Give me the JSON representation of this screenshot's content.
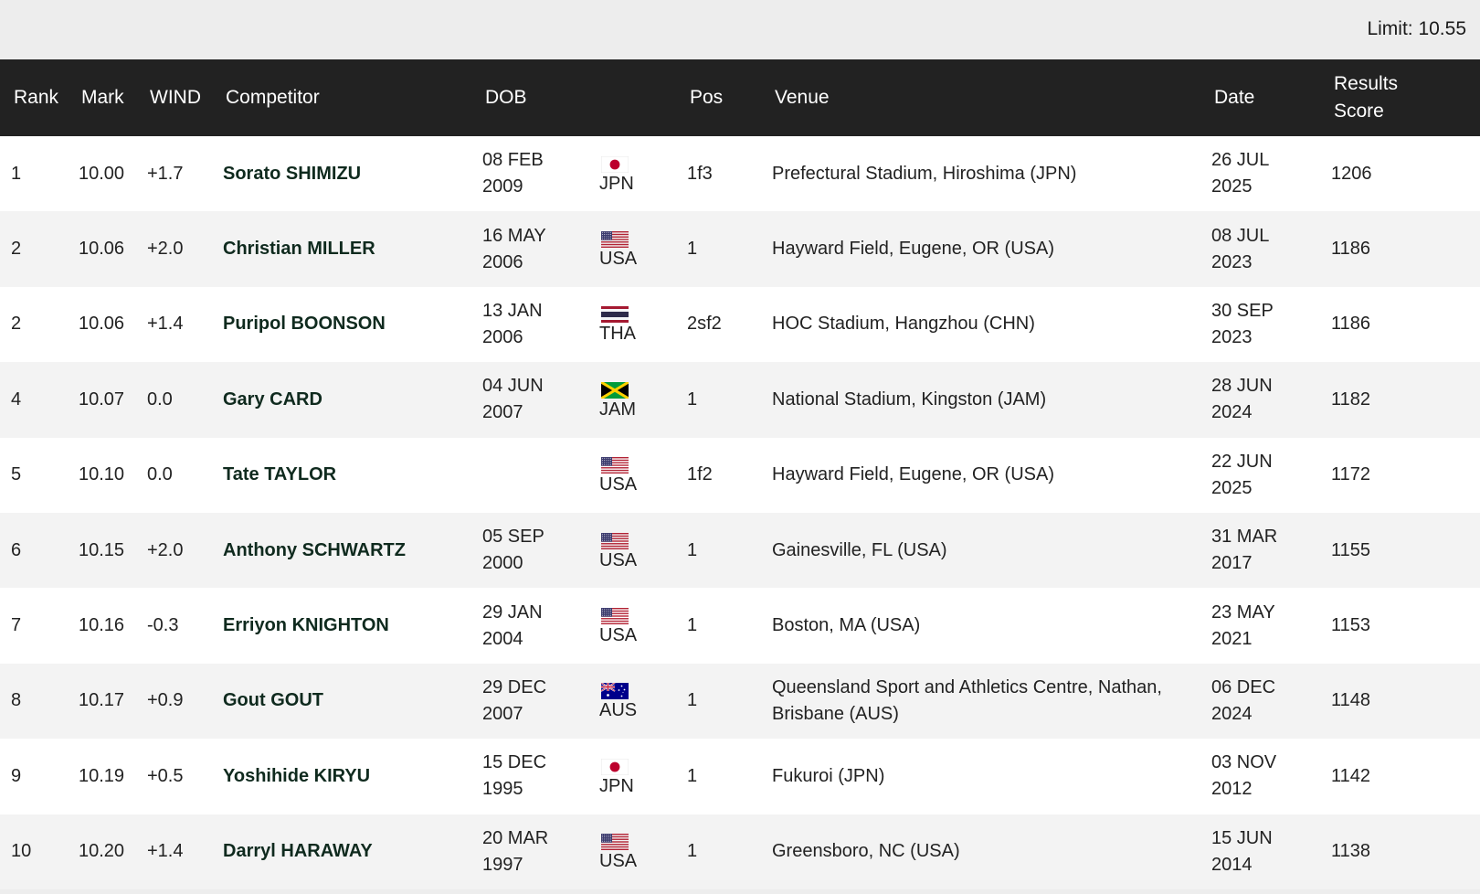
{
  "limit": "Limit: 10.55",
  "headers": {
    "rank": "Rank",
    "mark": "Mark",
    "wind": "WIND",
    "competitor": "Competitor",
    "dob": "DOB",
    "nat": "",
    "pos": "Pos",
    "venue": "Venue",
    "date": "Date",
    "score_line1": "Results",
    "score_line2": "Score"
  },
  "rows": [
    {
      "rank": "1",
      "mark": "10.00",
      "wind": "+1.7",
      "competitor": "Sorato SHIMIZU",
      "dob1": "08 FEB",
      "dob2": "2009",
      "nat": "JPN",
      "flag": "jpn-flag-icon",
      "pos": "1f3",
      "venue": "Prefectural Stadium, Hiroshima (JPN)",
      "date1": "26 JUL",
      "date2": "2025",
      "score": "1206"
    },
    {
      "rank": "2",
      "mark": "10.06",
      "wind": "+2.0",
      "competitor": "Christian MILLER",
      "dob1": "16 MAY",
      "dob2": "2006",
      "nat": "USA",
      "flag": "usa-flag-icon",
      "pos": "1",
      "venue": "Hayward Field, Eugene, OR (USA)",
      "date1": "08 JUL",
      "date2": "2023",
      "score": "1186"
    },
    {
      "rank": "2",
      "mark": "10.06",
      "wind": "+1.4",
      "competitor": "Puripol BOONSON",
      "dob1": "13 JAN",
      "dob2": "2006",
      "nat": "THA",
      "flag": "tha-flag-icon",
      "pos": "2sf2",
      "venue": "HOC Stadium, Hangzhou (CHN)",
      "date1": "30 SEP",
      "date2": "2023",
      "score": "1186"
    },
    {
      "rank": "4",
      "mark": "10.07",
      "wind": "0.0",
      "competitor": "Gary CARD",
      "dob1": "04 JUN",
      "dob2": "2007",
      "nat": "JAM",
      "flag": "jam-flag-icon",
      "pos": "1",
      "venue": "National Stadium, Kingston (JAM)",
      "date1": "28 JUN",
      "date2": "2024",
      "score": "1182"
    },
    {
      "rank": "5",
      "mark": "10.10",
      "wind": "0.0",
      "competitor": "Tate TAYLOR",
      "dob1": "",
      "dob2": "",
      "nat": "USA",
      "flag": "usa-flag-icon",
      "pos": "1f2",
      "venue": "Hayward Field, Eugene, OR (USA)",
      "date1": "22 JUN",
      "date2": "2025",
      "score": "1172"
    },
    {
      "rank": "6",
      "mark": "10.15",
      "wind": "+2.0",
      "competitor": "Anthony SCHWARTZ",
      "dob1": "05 SEP",
      "dob2": "2000",
      "nat": "USA",
      "flag": "usa-flag-icon",
      "pos": "1",
      "venue": "Gainesville, FL (USA)",
      "date1": "31 MAR",
      "date2": "2017",
      "score": "1155"
    },
    {
      "rank": "7",
      "mark": "10.16",
      "wind": "-0.3",
      "competitor": "Erriyon KNIGHTON",
      "dob1": "29 JAN",
      "dob2": "2004",
      "nat": "USA",
      "flag": "usa-flag-icon",
      "pos": "1",
      "venue": "Boston, MA (USA)",
      "date1": "23 MAY",
      "date2": "2021",
      "score": "1153"
    },
    {
      "rank": "8",
      "mark": "10.17",
      "wind": "+0.9",
      "competitor": "Gout GOUT",
      "dob1": "29 DEC",
      "dob2": "2007",
      "nat": "AUS",
      "flag": "aus-flag-icon",
      "pos": "1",
      "venue": "Queensland Sport and Athletics Centre, Nathan, Brisbane (AUS)",
      "date1": "06 DEC",
      "date2": "2024",
      "score": "1148"
    },
    {
      "rank": "9",
      "mark": "10.19",
      "wind": "+0.5",
      "competitor": "Yoshihide KIRYU",
      "dob1": "15 DEC",
      "dob2": "1995",
      "nat": "JPN",
      "flag": "jpn-flag-icon",
      "pos": "1",
      "venue": "Fukuroi (JPN)",
      "date1": "03 NOV",
      "date2": "2012",
      "score": "1142"
    },
    {
      "rank": "10",
      "mark": "10.20",
      "wind": "+1.4",
      "competitor": "Darryl HARAWAY",
      "dob1": "20 MAR",
      "dob2": "1997",
      "nat": "USA",
      "flag": "usa-flag-icon",
      "pos": "1",
      "venue": "Greensboro, NC (USA)",
      "date1": "15 JUN",
      "date2": "2014",
      "score": "1138"
    }
  ]
}
